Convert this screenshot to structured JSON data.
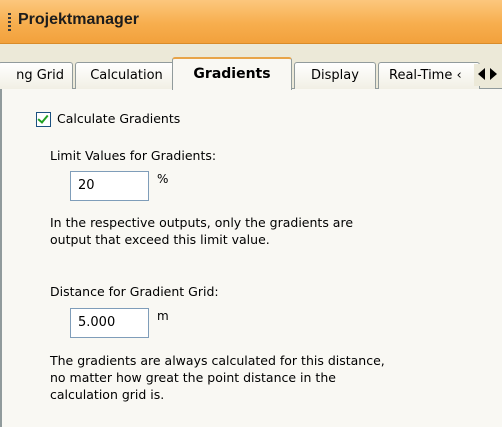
{
  "window": {
    "title": "Projektmanager"
  },
  "tabs": [
    "ng Grid",
    "Calculation",
    "Gradients",
    "Display",
    "Real-Time ‹"
  ],
  "gradients": {
    "calculate_label": "Calculate Gradients",
    "calculate_checked": true,
    "limit_label": "Limit Values for Gradients:",
    "limit_value": "20",
    "limit_unit": "%",
    "limit_help_line1": "In the respective outputs, only the gradients are",
    "limit_help_line2": "output that exceed this limit value.",
    "distance_label": "Distance for Gradient Grid:",
    "distance_value": "5.000",
    "distance_unit": "m",
    "distance_help_line1": "The gradients are always calculated for this distance,",
    "distance_help_line2": "no matter how great the point distance in the",
    "distance_help_line3": "calculation grid is."
  }
}
